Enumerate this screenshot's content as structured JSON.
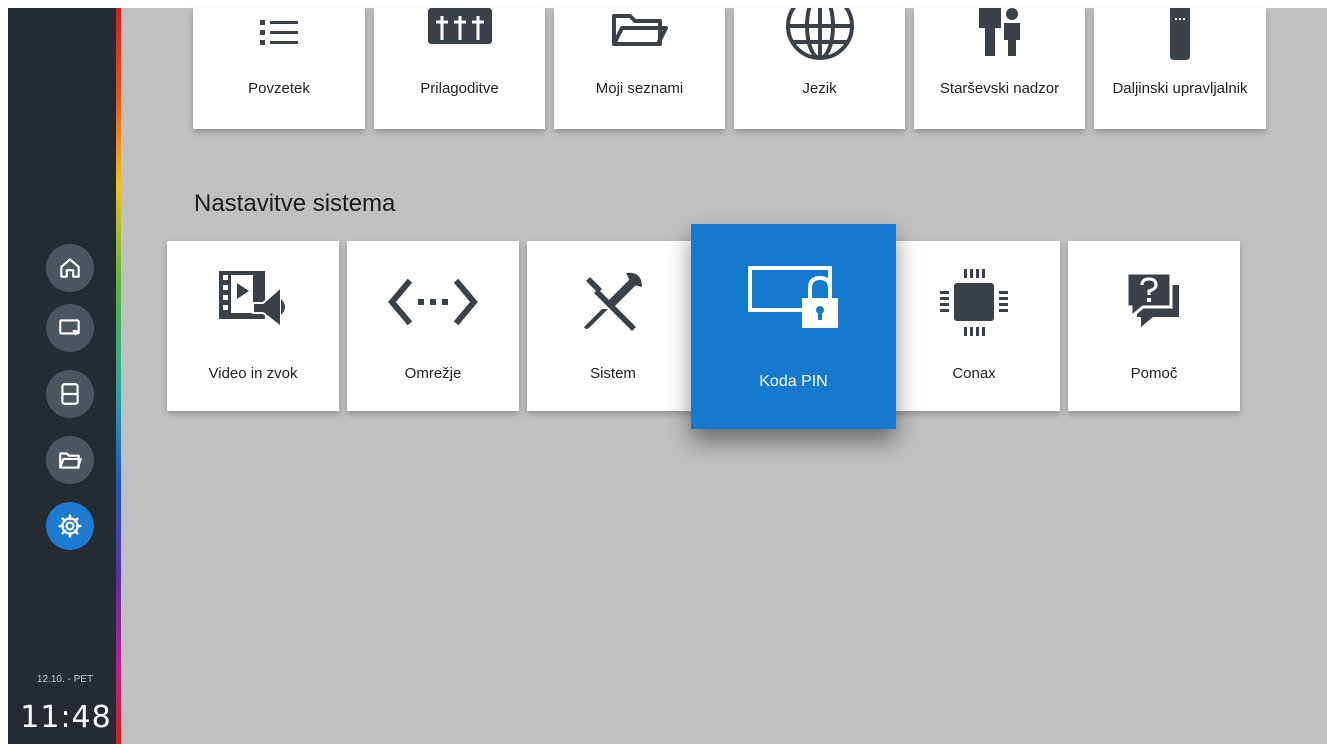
{
  "sidebar": {
    "items": [
      {
        "name": "home",
        "icon": "home-icon",
        "active": false
      },
      {
        "name": "tv",
        "icon": "tv-icon",
        "active": false
      },
      {
        "name": "recordings",
        "icon": "film-icon",
        "active": false
      },
      {
        "name": "folders",
        "icon": "folder-icon",
        "active": false
      },
      {
        "name": "settings",
        "icon": "gear-icon",
        "active": true
      }
    ],
    "date": "12.10. - PET",
    "time": "11:48"
  },
  "colors": {
    "accent": "#1679d0",
    "sidebar_bg": "#242b33",
    "content_bg": "#c0c0c0"
  },
  "top_row": {
    "tiles": [
      {
        "label": "Povzetek",
        "icon": "list-icon"
      },
      {
        "label": "Prilagoditve",
        "icon": "sliders-icon"
      },
      {
        "label": "Moji seznami",
        "icon": "folder-icon"
      },
      {
        "label": "Jezik",
        "icon": "globe-icon"
      },
      {
        "label": "Starševski nadzor",
        "icon": "parent-child-icon"
      },
      {
        "label": "Daljinski upravljalnik",
        "icon": "remote-control-icon"
      }
    ]
  },
  "system_section": {
    "title": "Nastavitve sistema",
    "tiles": [
      {
        "label": "Video in zvok",
        "icon": "video-audio-icon"
      },
      {
        "label": "Omrežje",
        "icon": "network-icon"
      },
      {
        "label": "Sistem",
        "icon": "tools-icon"
      },
      {
        "label": "Koda PIN",
        "icon": "screen-lock-icon",
        "focused": true
      },
      {
        "label": "Conax",
        "icon": "chip-icon"
      },
      {
        "label": "Pomoč",
        "icon": "help-chat-icon"
      }
    ]
  }
}
